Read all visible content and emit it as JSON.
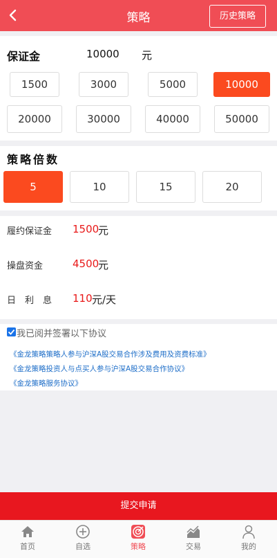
{
  "header": {
    "title": "策略",
    "history_label": "历史策略"
  },
  "margin": {
    "title": "保证金",
    "current_value": "10000",
    "unit": "元",
    "options": [
      "1500",
      "3000",
      "5000",
      "10000",
      "20000",
      "30000",
      "40000",
      "50000"
    ],
    "selected": "10000"
  },
  "multiplier": {
    "title": "策略倍数",
    "options": [
      "5",
      "10",
      "15",
      "20"
    ],
    "selected": "5"
  },
  "info": {
    "performance_margin": {
      "label": "履约保证金",
      "value": "1500",
      "unit": "元"
    },
    "trading_funds": {
      "label": "操盘资金",
      "value": "4500",
      "unit": "元"
    },
    "daily_interest": {
      "label_chars": [
        "日",
        "利",
        "息"
      ],
      "value": "110",
      "unit": "元/天"
    }
  },
  "agreement": {
    "checked": true,
    "text": "我已阅并签署以下协议",
    "links": [
      "《金龙策略策略人参与沪深A股交易合作涉及费用及资费标准》",
      "《金龙策略投资人与点买人参与沪深A股交易合作协议》",
      "《金龙策略服务协议》"
    ]
  },
  "submit_label": "提交申请",
  "tabbar": {
    "items": [
      {
        "label": "首页",
        "icon": "home-icon"
      },
      {
        "label": "自选",
        "icon": "plus-circle-icon"
      },
      {
        "label": "策略",
        "icon": "target-icon"
      },
      {
        "label": "交易",
        "icon": "chart-icon"
      },
      {
        "label": "我的",
        "icon": "user-icon"
      }
    ],
    "active": "策略"
  },
  "colors": {
    "header": "#f04d55",
    "active_option": "#fb4a1f",
    "submit": "#e8171f",
    "value_red": "#e81818",
    "link_blue": "#1e6ec8"
  }
}
